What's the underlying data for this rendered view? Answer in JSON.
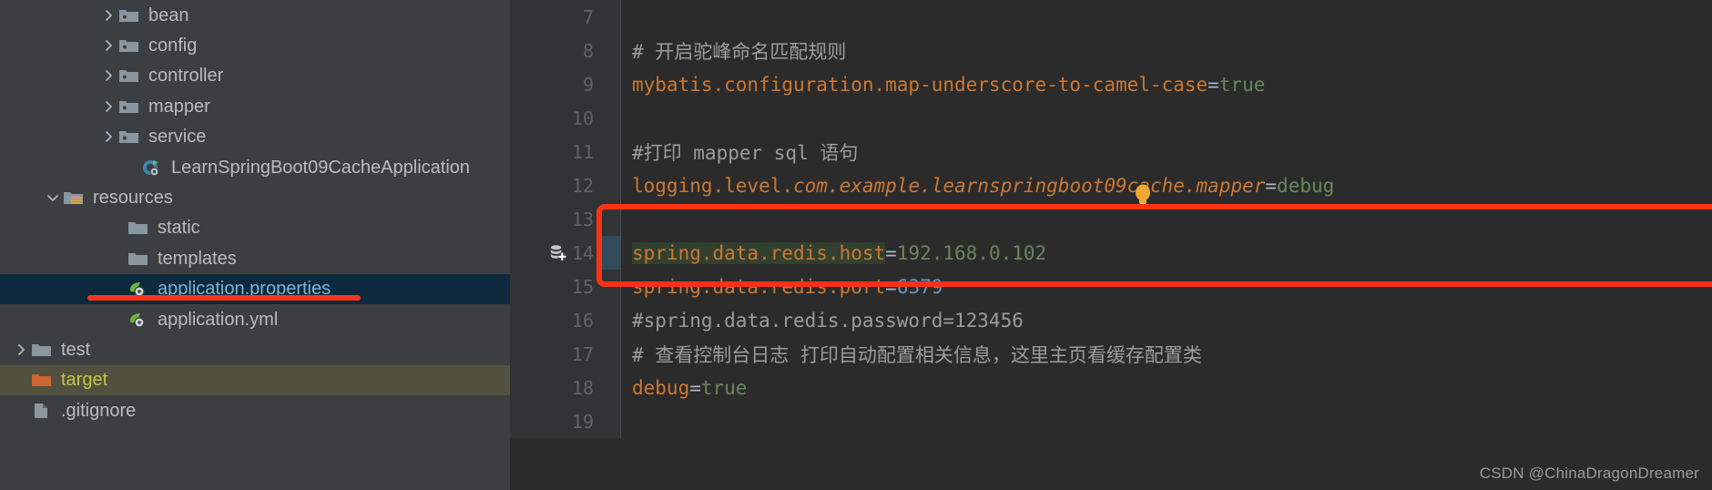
{
  "sidebar": {
    "items": [
      {
        "label": "bean",
        "icon": "package-folder-icon",
        "arrow": "chevron-right",
        "indent": 108,
        "state": "normal"
      },
      {
        "label": "config",
        "icon": "package-folder-icon",
        "arrow": "chevron-right",
        "indent": 108,
        "state": "normal"
      },
      {
        "label": "controller",
        "icon": "package-folder-icon",
        "arrow": "chevron-right",
        "indent": 108,
        "state": "normal"
      },
      {
        "label": "mapper",
        "icon": "package-folder-icon",
        "arrow": "chevron-right",
        "indent": 108,
        "state": "normal"
      },
      {
        "label": "service",
        "icon": "package-folder-icon",
        "arrow": "chevron-right",
        "indent": 108,
        "state": "normal"
      },
      {
        "label": "LearnSpringBoot09CacheApplication",
        "icon": "spring-class-icon",
        "arrow": "none",
        "indent": 133,
        "state": "normal"
      },
      {
        "label": "resources",
        "icon": "resources-folder-icon",
        "arrow": "chevron-down",
        "indent": 47,
        "state": "normal"
      },
      {
        "label": "static",
        "icon": "folder-icon",
        "arrow": "none",
        "indent": 118,
        "state": "normal"
      },
      {
        "label": "templates",
        "icon": "folder-icon",
        "arrow": "none",
        "indent": 118,
        "state": "normal"
      },
      {
        "label": "application.properties",
        "icon": "spring-leaf-icon",
        "arrow": "none",
        "indent": 118,
        "state": "selected"
      },
      {
        "label": "application.yml",
        "icon": "spring-leaf-icon",
        "arrow": "none",
        "indent": 118,
        "state": "normal"
      },
      {
        "label": "test",
        "icon": "folder-icon",
        "arrow": "chevron-right",
        "indent": 12,
        "state": "normal"
      },
      {
        "label": "target",
        "icon": "excluded-folder-icon",
        "arrow": "none",
        "indent": 12,
        "state": "target"
      },
      {
        "label": ".gitignore",
        "icon": "file-icon",
        "arrow": "none",
        "indent": 12,
        "state": "normal"
      }
    ],
    "selected_color": "#0d293e",
    "selected_text_color": "#83b0d4",
    "target_color": "#52503f",
    "target_text_color": "#c9c343"
  },
  "editor": {
    "lines": [
      {
        "number": "7",
        "gutter_icon": "none",
        "breakpoint_stripe": false,
        "highlight_key": false,
        "segments": []
      },
      {
        "number": "8",
        "gutter_icon": "none",
        "breakpoint_stripe": false,
        "highlight_key": false,
        "segments": [
          {
            "t": "# 开启驼峰命名匹配规则",
            "c": "comment"
          }
        ]
      },
      {
        "number": "9",
        "gutter_icon": "none",
        "breakpoint_stripe": false,
        "highlight_key": false,
        "segments": [
          {
            "t": "mybatis.configuration.map-underscore-to-camel-case",
            "c": "key"
          },
          {
            "t": "=",
            "c": "sep"
          },
          {
            "t": "true",
            "c": "val-green"
          }
        ]
      },
      {
        "number": "10",
        "gutter_icon": "none",
        "breakpoint_stripe": false,
        "highlight_key": false,
        "segments": []
      },
      {
        "number": "11",
        "gutter_icon": "none",
        "breakpoint_stripe": false,
        "highlight_key": false,
        "segments": [
          {
            "t": "#打印 mapper sql 语句",
            "c": "comment"
          }
        ]
      },
      {
        "number": "12",
        "gutter_icon": "none",
        "breakpoint_stripe": false,
        "highlight_key": false,
        "segments": [
          {
            "t": "logging.level.",
            "c": "key"
          },
          {
            "t": "com.example.learnspringboot09cache.mapper",
            "c": "key-em"
          },
          {
            "t": "=",
            "c": "sep"
          },
          {
            "t": "debug",
            "c": "val-green"
          }
        ]
      },
      {
        "number": "13",
        "gutter_icon": "none",
        "breakpoint_stripe": false,
        "highlight_key": false,
        "segments": []
      },
      {
        "number": "14",
        "gutter_icon": "database-add-icon",
        "breakpoint_stripe": true,
        "highlight_key": true,
        "segments": [
          {
            "t": "spring.data.redis.host",
            "c": "key"
          },
          {
            "t": "=",
            "c": "sep"
          },
          {
            "t": "192.168.0.102",
            "c": "val-green"
          }
        ]
      },
      {
        "number": "15",
        "gutter_icon": "none",
        "breakpoint_stripe": false,
        "highlight_key": false,
        "segments": [
          {
            "t": "spring.data.redis.port",
            "c": "key"
          },
          {
            "t": "=",
            "c": "sep"
          },
          {
            "t": "6379",
            "c": "val-blue"
          }
        ]
      },
      {
        "number": "16",
        "gutter_icon": "none",
        "breakpoint_stripe": false,
        "highlight_key": false,
        "segments": [
          {
            "t": "#spring.data.redis.password=123456",
            "c": "comment"
          }
        ]
      },
      {
        "number": "17",
        "gutter_icon": "none",
        "breakpoint_stripe": false,
        "highlight_key": false,
        "segments": [
          {
            "t": "# 查看控制台日志 打印自动配置相关信息，这里主页看缓存配置类",
            "c": "comment"
          }
        ]
      },
      {
        "number": "18",
        "gutter_icon": "none",
        "breakpoint_stripe": false,
        "highlight_key": false,
        "segments": [
          {
            "t": "debug",
            "c": "key"
          },
          {
            "t": "=",
            "c": "sep"
          },
          {
            "t": "true",
            "c": "val-green"
          }
        ]
      },
      {
        "number": "19",
        "gutter_icon": "none",
        "breakpoint_stripe": false,
        "highlight_key": false,
        "segments": []
      }
    ],
    "intention_bulb": "lightbulb-icon",
    "colors": {
      "background": "#2b2b2b",
      "gutter_background": "#313335",
      "key": "#cc7832",
      "separator": "#a9b7c6",
      "value_string": "#6a8759",
      "value_number": "#6897bb",
      "comment": "#9c9c9c",
      "key_highlight_background": "#32402f",
      "breakpoint_stripe": "#2f4b5c"
    }
  },
  "annotations": {
    "redis_box_color": "#fc3316",
    "file_underline_color": "#fc3316"
  },
  "watermark": {
    "text": "CSDN @ChinaDragonDreamer"
  }
}
